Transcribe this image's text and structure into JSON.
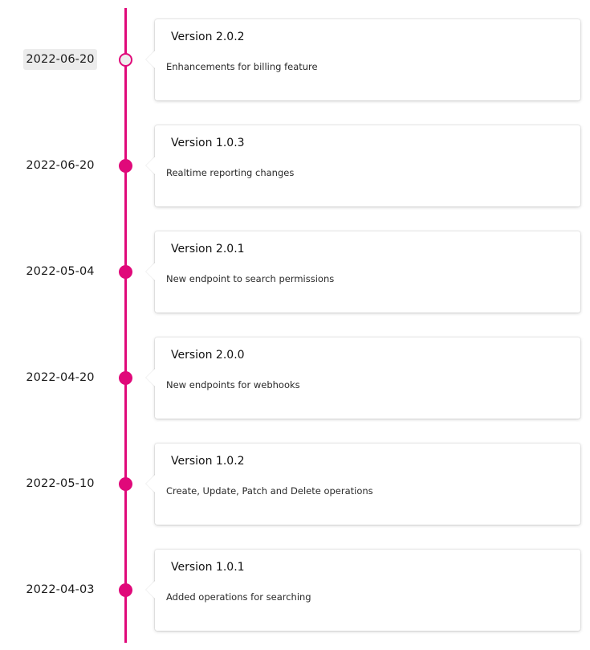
{
  "colors": {
    "accent": "#e0097a",
    "card_background": "#ffffff",
    "date_highlight": "#ececec"
  },
  "entries": [
    {
      "date": "2022-06-20",
      "title": "Version 2.0.2",
      "description": "Enhancements for billing feature",
      "marker": "hollow",
      "date_highlighted": true
    },
    {
      "date": "2022-06-20",
      "title": "Version 1.0.3",
      "description": "Realtime reporting changes",
      "marker": "filled",
      "date_highlighted": false
    },
    {
      "date": "2022-05-04",
      "title": "Version 2.0.1",
      "description": "New endpoint to search permissions",
      "marker": "filled",
      "date_highlighted": false
    },
    {
      "date": "2022-04-20",
      "title": "Version 2.0.0",
      "description": "New endpoints for webhooks",
      "marker": "filled",
      "date_highlighted": false
    },
    {
      "date": "2022-05-10",
      "title": "Version 1.0.2",
      "description": "Create, Update, Patch and Delete operations",
      "marker": "filled",
      "date_highlighted": false
    },
    {
      "date": "2022-04-03",
      "title": "Version 1.0.1",
      "description": "Added operations for searching",
      "marker": "filled",
      "date_highlighted": false
    }
  ]
}
